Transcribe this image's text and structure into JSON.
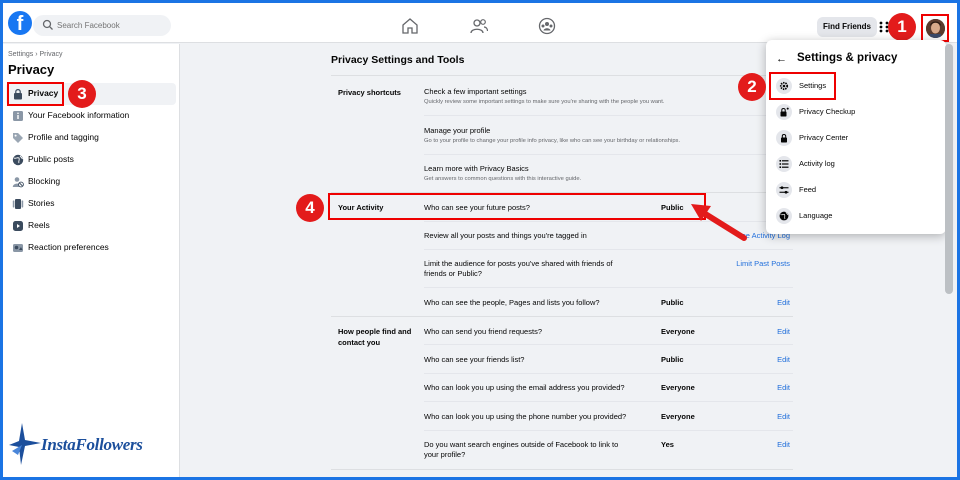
{
  "topbar": {
    "search_placeholder": "Search Facebook",
    "find_friends_label": "Find Friends"
  },
  "sidebar": {
    "breadcrumb": "Settings › Privacy",
    "title": "Privacy",
    "items": [
      {
        "label": "Privacy",
        "icon": "lock-icon"
      },
      {
        "label": "Your Facebook information",
        "icon": "info-icon"
      },
      {
        "label": "Profile and tagging",
        "icon": "tag-icon"
      },
      {
        "label": "Public posts",
        "icon": "globe-icon"
      },
      {
        "label": "Blocking",
        "icon": "block-user-icon"
      },
      {
        "label": "Stories",
        "icon": "stories-icon"
      },
      {
        "label": "Reels",
        "icon": "reels-icon"
      },
      {
        "label": "Reaction preferences",
        "icon": "reaction-icon"
      }
    ]
  },
  "main": {
    "title": "Privacy Settings and Tools",
    "sections": {
      "shortcuts": {
        "label": "Privacy shortcuts",
        "rows": [
          {
            "title": "Check a few important settings",
            "sub": "Quickly review some important settings to make sure you're sharing with the people you want."
          },
          {
            "title": "Manage your profile",
            "sub": "Go to your profile to change your profile info privacy, like who can see your birthday or relationships."
          },
          {
            "title": "Learn more with Privacy Basics",
            "sub": "Get answers to common questions with this interactive guide."
          }
        ]
      },
      "activity": {
        "label": "Your Activity",
        "rows": [
          {
            "question": "Who can see your future posts?",
            "value": "Public",
            "link": ""
          },
          {
            "question": "Review all your posts and things you're tagged in",
            "value": "",
            "link": "Use Activity Log"
          },
          {
            "question": "Limit the audience for posts you've shared with friends of friends or Public?",
            "value": "",
            "link": "Limit Past Posts"
          },
          {
            "question": "Who can see the people, Pages and lists you follow?",
            "value": "Public",
            "link": "Edit"
          }
        ]
      },
      "contact": {
        "label": "How people find and contact you",
        "rows": [
          {
            "question": "Who can send you friend requests?",
            "value": "Everyone",
            "link": "Edit"
          },
          {
            "question": "Who can see your friends list?",
            "value": "Public",
            "link": "Edit"
          },
          {
            "question": "Who can look you up using the email address you provided?",
            "value": "Everyone",
            "link": "Edit"
          },
          {
            "question": "Who can look you up using the phone number you provided?",
            "value": "Everyone",
            "link": "Edit"
          },
          {
            "question": "Do you want search engines outside of Facebook to link to your profile?",
            "value": "Yes",
            "link": "Edit"
          }
        ]
      }
    }
  },
  "dropdown": {
    "back_symbol": "←",
    "title": "Settings & privacy",
    "items": [
      {
        "label": "Settings",
        "icon": "gear-icon"
      },
      {
        "label": "Privacy Checkup",
        "icon": "lock-check-icon"
      },
      {
        "label": "Privacy Center",
        "icon": "lock-icon"
      },
      {
        "label": "Activity log",
        "icon": "list-icon"
      },
      {
        "label": "Feed",
        "icon": "sliders-icon"
      },
      {
        "label": "Language",
        "icon": "globe-icon"
      }
    ]
  },
  "badges": {
    "one": "1",
    "two": "2",
    "three": "3",
    "four": "4"
  },
  "brand": {
    "name": "InstaFollowers"
  },
  "colors": {
    "accent": "#1877f2",
    "highlight": "#e31b1b",
    "link": "#216fdb"
  }
}
